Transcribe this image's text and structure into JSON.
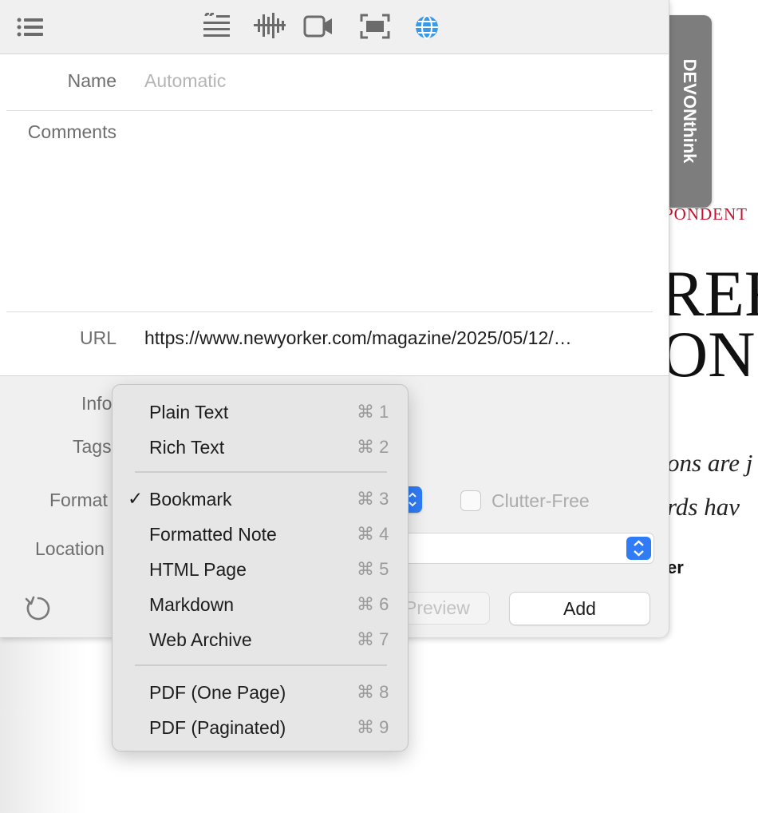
{
  "background_page": {
    "kicker": "PONDENT",
    "headline_lines": [
      "REF",
      "ON"
    ],
    "dek_lines": [
      "ons are j",
      "rds hav"
    ],
    "byline": "er"
  },
  "devon_tab": {
    "label": "DEVONthink"
  },
  "toolbar": {
    "icons": [
      "list-icon",
      "quote-text-icon",
      "audio-waveform-icon",
      "video-camera-icon",
      "screen-capture-icon",
      "globe-icon"
    ]
  },
  "form": {
    "name_label": "Name",
    "name_placeholder": "Automatic",
    "comments_label": "Comments",
    "url_label": "URL",
    "url_value": "https://www.newyorker.com/magazine/2025/05/12/…",
    "info_label": "Info",
    "tags_label": "Tags",
    "format_label": "Format",
    "location_label": "Location",
    "clutter_free_label": "Clutter-Free",
    "clutter_free_checked": false,
    "preview_label": "Preview",
    "add_label": "Add"
  },
  "format_menu": {
    "selected": "Bookmark",
    "groups": [
      [
        {
          "label": "Plain Text",
          "shortcut": "⌘ 1",
          "checked": false
        },
        {
          "label": "Rich Text",
          "shortcut": "⌘ 2",
          "checked": false
        }
      ],
      [
        {
          "label": "Bookmark",
          "shortcut": "⌘ 3",
          "checked": true
        },
        {
          "label": "Formatted Note",
          "shortcut": "⌘ 4",
          "checked": false
        },
        {
          "label": "HTML Page",
          "shortcut": "⌘ 5",
          "checked": false
        },
        {
          "label": "Markdown",
          "shortcut": "⌘ 6",
          "checked": false
        },
        {
          "label": "Web Archive",
          "shortcut": "⌘ 7",
          "checked": false
        }
      ],
      [
        {
          "label": "PDF (One Page)",
          "shortcut": "⌘ 8",
          "checked": false
        },
        {
          "label": "PDF (Paginated)",
          "shortcut": "⌘ 9",
          "checked": false
        }
      ]
    ]
  },
  "colors": {
    "accent": "#2f7cf6",
    "globe": "#3b9ae8",
    "kicker_red": "#c8102e",
    "tab_gray": "#7d7d7d"
  }
}
